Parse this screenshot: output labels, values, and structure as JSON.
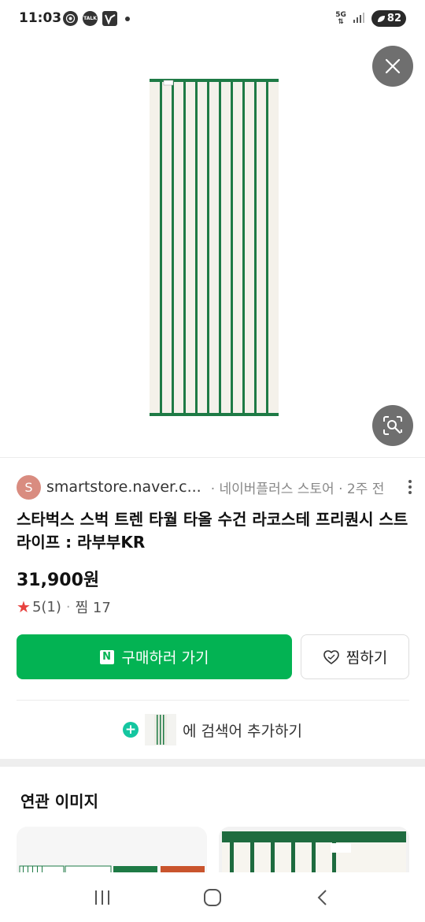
{
  "status_bar": {
    "time": "11:03",
    "talk_badge": "TALK",
    "network": "5G",
    "battery": "82"
  },
  "icons": {
    "close": "close-icon",
    "lens": "image-search-icon",
    "more": "more-vertical-icon",
    "heart": "heart-icon",
    "plus": "plus-icon",
    "star": "star-icon"
  },
  "source": {
    "avatar_letter": "S",
    "domain": "smartstore.naver.c...",
    "meta": "· 네이버플러스 스토어 · 2주 전"
  },
  "product": {
    "title": "스타벅스 스벅 트렌 타월 타올 수건 라코스테 프리퀀시 스트라이프 : 라부부KR",
    "price": "31,900원",
    "rating": "5(1)",
    "separator": "·",
    "saves": "찜 17"
  },
  "actions": {
    "buy_logo": "N",
    "buy_label": "구매하러 가기",
    "save_label": "찜하기"
  },
  "add_search": {
    "label": "에 검색어 추가하기"
  },
  "related": {
    "title": "연관 이미지"
  },
  "colors": {
    "accent_green": "#03b353",
    "stripe_green": "#1e7a45",
    "star_red": "#e8423f"
  }
}
